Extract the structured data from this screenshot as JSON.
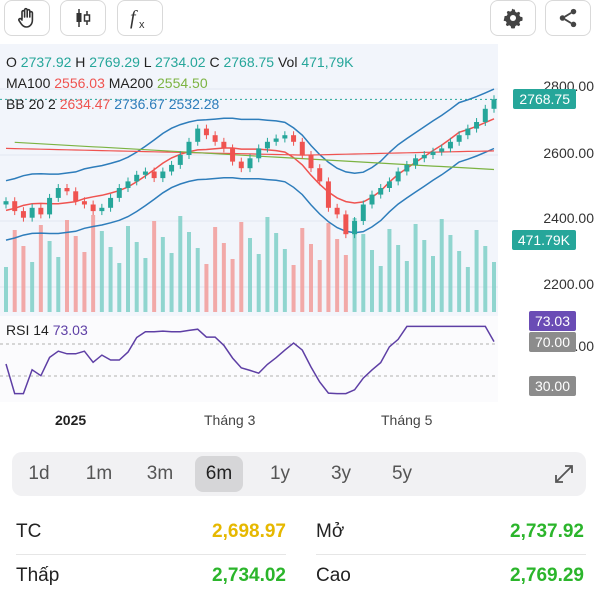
{
  "toolbar": {
    "left_icons": [
      "hand-icon",
      "candlestick-icon",
      "function-icon"
    ],
    "right_icons": [
      "gear-icon",
      "share-icon"
    ]
  },
  "legend": {
    "o_label": "O",
    "o_val": "2737.92",
    "h_label": "H",
    "h_val": "2769.29",
    "l_label": "L",
    "l_val": "2734.02",
    "c_label": "C",
    "c_val": "2768.75",
    "vol_label": "Vol",
    "vol_val": "471,79K",
    "ma100_label": "MA100",
    "ma100_val": "2556.03",
    "ma200_label": "MA200",
    "ma200_val": "2554.50",
    "bb_label": "BB 20 2",
    "bb_mid": "2634.47",
    "bb_up": "2736.67",
    "bb_low": "2532.28",
    "rsi_label": "RSI 14",
    "rsi_val": "73.03"
  },
  "y_axis": {
    "ticks": [
      "2800.00",
      "2600.00",
      "2400.00",
      "2200.00",
      "2000.00"
    ],
    "price_tag": "2768.75",
    "volume_tag": "471.79K",
    "rsi_tag": "73.03",
    "rsi_upper": "70.00",
    "rsi_lower": "30.00"
  },
  "x_axis": {
    "labels": [
      "2025",
      "Tháng 3",
      "Tháng 5"
    ]
  },
  "ranges": {
    "items": [
      "1d",
      "1m",
      "3m",
      "6m",
      "1y",
      "3y",
      "5y"
    ],
    "active": "6m",
    "expand_icon": "expand-icon"
  },
  "stats": {
    "tc_label": "TC",
    "tc_val": "2,698.97",
    "mo_label": "Mở",
    "mo_val": "2,737.92",
    "thap_label": "Thấp",
    "thap_val": "2,734.02",
    "cao_label": "Cao",
    "cao_val": "2,769.29"
  },
  "colors": {
    "up": "#26a69a",
    "down": "#ef5350",
    "bb": "#2e7dbb",
    "ma": "#7cb342",
    "rsi": "#5e3fa5",
    "reference": "#e6b800",
    "gain": "#2bb52b"
  },
  "chart_data": {
    "type": "candlestick",
    "period": "6m",
    "last": {
      "open": 2737.92,
      "high": 2769.29,
      "low": 2734.02,
      "close": 2768.75,
      "volume": "471.79K"
    },
    "close_series_approx": [
      2460,
      2430,
      2410,
      2440,
      2420,
      2470,
      2500,
      2490,
      2460,
      2450,
      2430,
      2440,
      2470,
      2500,
      2520,
      2540,
      2550,
      2530,
      2550,
      2570,
      2600,
      2640,
      2680,
      2660,
      2640,
      2620,
      2580,
      2560,
      2590,
      2620,
      2640,
      2650,
      2660,
      2640,
      2600,
      2560,
      2520,
      2440,
      2420,
      2360,
      2400,
      2450,
      2480,
      2500,
      2520,
      2550,
      2570,
      2590,
      2600,
      2610,
      2620,
      2640,
      2660,
      2680,
      2700,
      2740,
      2769
    ],
    "bb": {
      "upper": 2736.67,
      "middle": 2634.47,
      "lower": 2532.28
    },
    "ma100": 2556.03,
    "ma200": 2554.5,
    "rsi": 73.03,
    "rsi_bands": [
      30,
      70
    ],
    "y_ticks": [
      2000,
      2200,
      2400,
      2600,
      2800
    ]
  }
}
